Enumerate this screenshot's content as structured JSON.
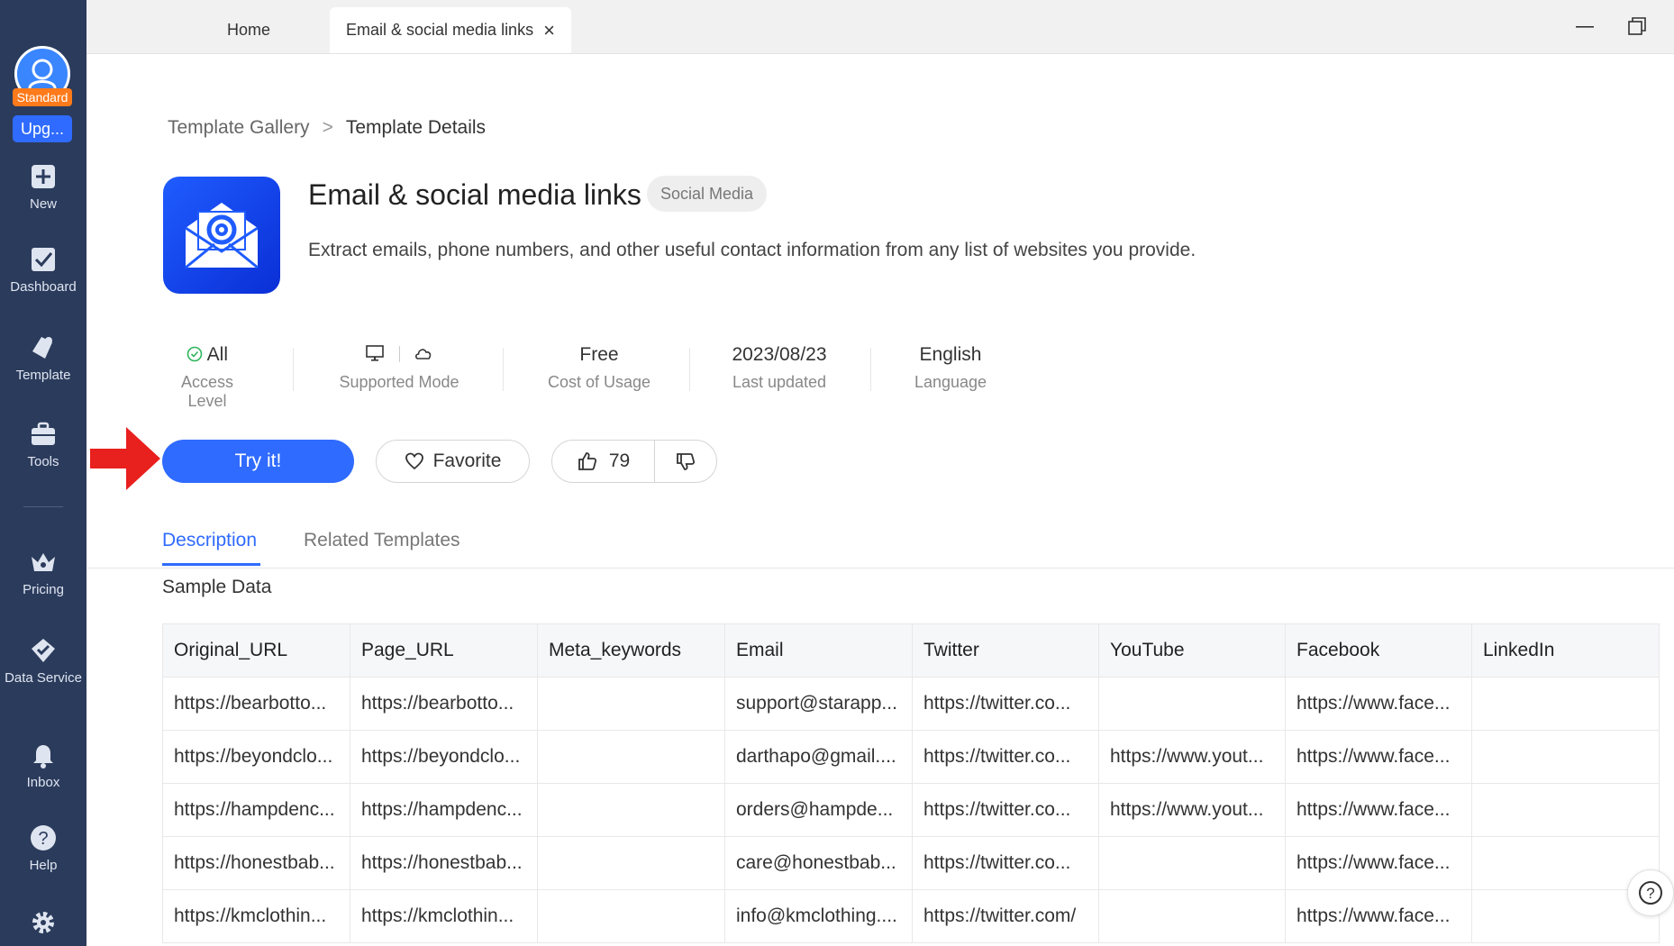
{
  "sidebar": {
    "plan_badge": "Standard",
    "upgrade_label": "Upg...",
    "items": [
      {
        "label": "New",
        "icon": "plus-square-icon"
      },
      {
        "label": "Dashboard",
        "icon": "dashboard-icon"
      },
      {
        "label": "Template",
        "icon": "template-icon"
      },
      {
        "label": "Tools",
        "icon": "toolbox-icon"
      },
      {
        "label": "Pricing",
        "icon": "crown-icon"
      },
      {
        "label": "Data Service",
        "icon": "data-service-icon"
      },
      {
        "label": "Inbox",
        "icon": "bell-icon"
      },
      {
        "label": "Help",
        "icon": "help-icon"
      },
      {
        "label": "",
        "icon": "gear-icon"
      }
    ]
  },
  "tabs": {
    "home": "Home",
    "active": "Email & social media links"
  },
  "breadcrumb": {
    "parent": "Template Gallery",
    "current": "Template Details"
  },
  "template": {
    "title": "Email & social media links",
    "tag": "Social Media",
    "description": "Extract emails, phone numbers, and other useful contact information from any list of websites you provide."
  },
  "meta": {
    "access_value": "All",
    "access_label": "Access Level",
    "mode_label": "Supported Mode",
    "cost_value": "Free",
    "cost_label": "Cost of Usage",
    "updated_value": "2023/08/23",
    "updated_label": "Last updated",
    "language_value": "English",
    "language_label": "Language"
  },
  "actions": {
    "try_label": "Try it!",
    "favorite_label": "Favorite",
    "likes": "79"
  },
  "content_tabs": {
    "description": "Description",
    "related": "Related Templates"
  },
  "sample": {
    "title": "Sample Data",
    "columns": [
      "Original_URL",
      "Page_URL",
      "Meta_keywords",
      "Email",
      "Twitter",
      "YouTube",
      "Facebook",
      "LinkedIn"
    ],
    "rows": [
      [
        "https://bearbotto...",
        "https://bearbotto...",
        "",
        "support@starapp...",
        "https://twitter.co...",
        "",
        "https://www.face...",
        ""
      ],
      [
        "https://beyondclo...",
        "https://beyondclo...",
        "",
        "darthapo@gmail....",
        "https://twitter.co...",
        "https://www.yout...",
        "https://www.face...",
        ""
      ],
      [
        "https://hampdenc...",
        "https://hampdenc...",
        "",
        "orders@hampde...",
        "https://twitter.co...",
        "https://www.yout...",
        "https://www.face...",
        ""
      ],
      [
        "https://honestbab...",
        "https://honestbab...",
        "",
        "care@honestbab...",
        "https://twitter.co...",
        "",
        "https://www.face...",
        ""
      ],
      [
        "https://kmclothin...",
        "https://kmclothin...",
        "",
        "info@kmclothing....",
        "https://twitter.com/",
        "",
        "https://www.face...",
        ""
      ]
    ]
  },
  "colors": {
    "sidebar_bg": "#2b3b5c",
    "accent": "#2f6bff",
    "badge_orange": "#ff7a1a",
    "arrow_red": "#e8201e",
    "check_green": "#2db55d"
  }
}
